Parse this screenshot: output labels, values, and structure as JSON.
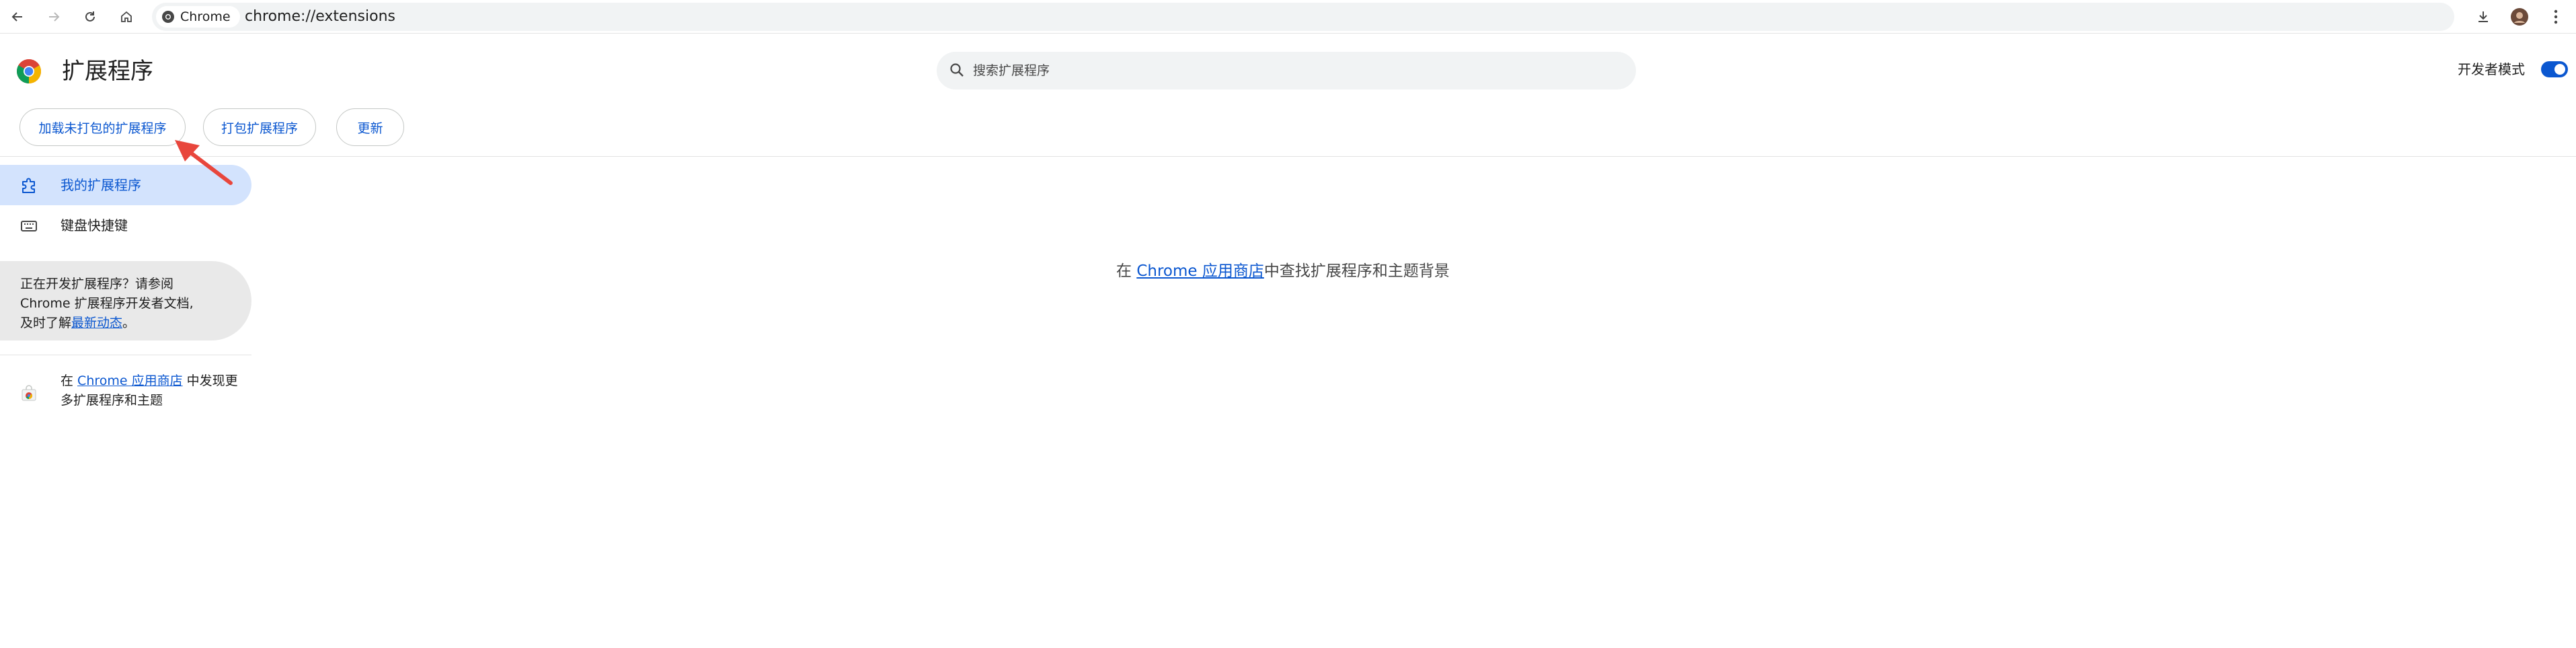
{
  "browser": {
    "chip_label": "Chrome",
    "url": "chrome://extensions"
  },
  "header": {
    "title": "扩展程序",
    "search_placeholder": "搜索扩展程序",
    "developer_mode_label": "开发者模式",
    "developer_mode_on": true,
    "buttons": {
      "load_unpacked": "加载未打包的扩展程序",
      "pack": "打包扩展程序",
      "update": "更新"
    }
  },
  "sidebar": {
    "items": [
      {
        "label": "我的扩展程序",
        "icon": "extension-icon",
        "active": true
      },
      {
        "label": "键盘快捷键",
        "icon": "keyboard-icon",
        "active": false
      }
    ],
    "dev_card": {
      "text_line1": "正在开发扩展程序？请参阅",
      "text_line2": "Chrome 扩展程序开发者文档,",
      "text_line3_prefix": "及时了解",
      "link": "最新动态",
      "text_line3_suffix": "。"
    },
    "store_promo": {
      "prefix": "在 ",
      "link": "Chrome 应用商店",
      "suffix": " 中发现更多扩展程序和主题"
    }
  },
  "main": {
    "empty_prefix": "在 ",
    "empty_link": "Chrome 应用商店",
    "empty_suffix": "中查找扩展程序和主题背景"
  },
  "colors": {
    "accent": "#0b57d0",
    "active_nav_bg": "#d3e3fd",
    "annotation_arrow": "#e8463c"
  }
}
